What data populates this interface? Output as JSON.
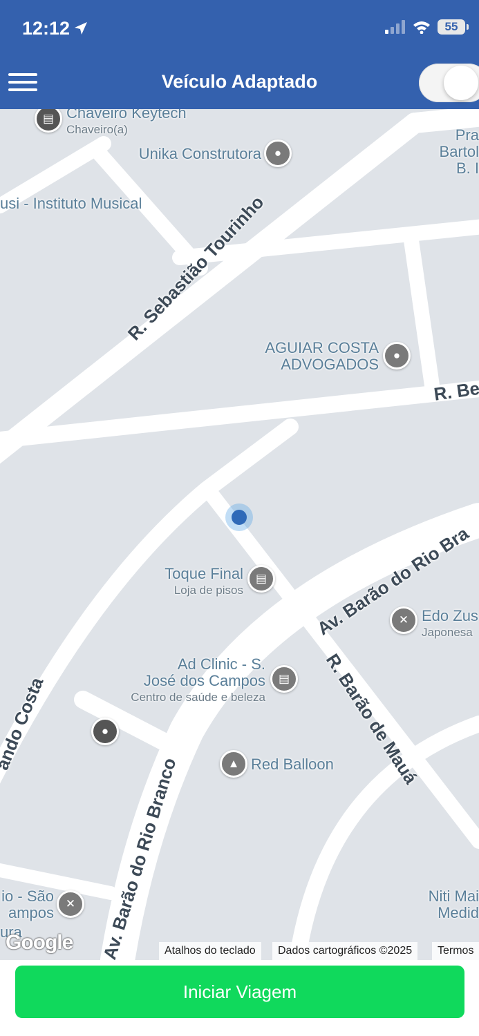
{
  "status": {
    "time": "12:12",
    "battery": "55",
    "location_icon": "location-arrow-icon"
  },
  "header": {
    "title": "Veículo Adaptado",
    "menu_icon": "hamburger-menu-icon",
    "toggle_state": "on"
  },
  "map": {
    "pois": [
      {
        "name": "Chaveiro Keytech",
        "sub": "Chaveiro(a)"
      },
      {
        "name": "Unika Construtora"
      },
      {
        "name": "usi - Instituto Musical"
      },
      {
        "name": "Pra",
        "name2": "Bartol",
        "name3": "B. I"
      },
      {
        "name": "AGUIAR COSTA",
        "name2": "ADVOGADOS"
      },
      {
        "name": "Toque Final",
        "sub": "Loja de pisos"
      },
      {
        "name": "Edo Zus",
        "sub": "Japonesa"
      },
      {
        "name": "Ad Clinic - S.",
        "name2": "José dos Campos",
        "sub": "Centro de saúde e beleza"
      },
      {
        "name": "Red Balloon"
      },
      {
        "name": "io - São",
        "name2": "ampos"
      },
      {
        "name": "Niti Mai",
        "name2": "Medid"
      },
      {
        "name": "ura"
      }
    ],
    "streets": [
      "R. Sebastião Tourinho",
      "R. Be",
      "Av. Barão do Rio Bra",
      "R. Barão de Mauá",
      "Av. Barão do Rio Branco",
      "ando Costa"
    ],
    "google_logo": "Google",
    "attribution": {
      "shortcuts": "Atalhos do teclado",
      "data": "Dados cartográficos ©2025",
      "terms": "Termos"
    }
  },
  "footer": {
    "start_label": "Iniciar Viagem"
  }
}
